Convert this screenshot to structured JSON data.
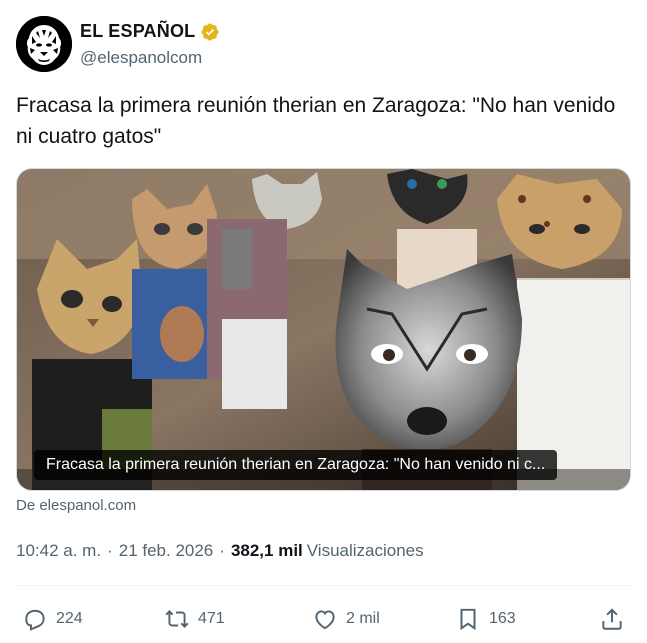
{
  "author": {
    "display_name": "EL ESPAÑOL",
    "handle": "@elespanolcom",
    "verified_color": "#e2b719"
  },
  "tweet": {
    "text": "Fracasa la primera reunión therian en Zaragoza: \"No han venido ni cuatro gatos\""
  },
  "card": {
    "caption": "Fracasa la primera reunión therian en Zaragoza: \"No han venido ni c...",
    "source": "De elespanol.com"
  },
  "meta": {
    "time": "10:42 a. m.",
    "separator": "·",
    "date": "21 feb. 2026",
    "views_count": "382,1 mil",
    "views_label": "Visualizaciones"
  },
  "actions": {
    "replies": "224",
    "reposts": "471",
    "likes": "2 mil",
    "bookmarks": "163",
    "icons": [
      "reply-icon",
      "repost-icon",
      "like-icon",
      "bookmark-icon",
      "share-icon"
    ]
  },
  "colors": {
    "text_primary": "#0f1419",
    "text_secondary": "#536471",
    "border": "#cfd9de"
  }
}
